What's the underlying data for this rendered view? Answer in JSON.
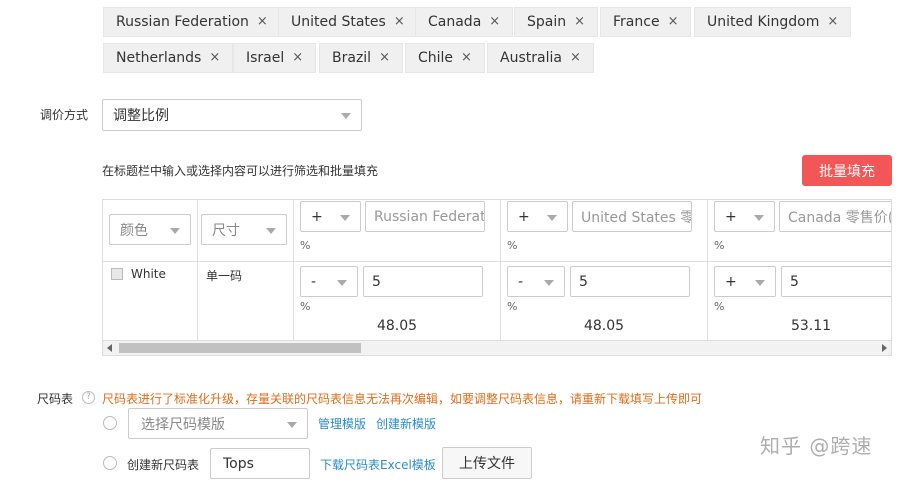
{
  "countries": [
    "Russian Federation",
    "United States",
    "Canada",
    "Spain",
    "France",
    "United Kingdom",
    "Netherlands",
    "Israel",
    "Brazil",
    "Chile",
    "Australia"
  ],
  "remove_glyph": "×",
  "pricing": {
    "label": "调价方式",
    "value": "调整比例"
  },
  "table_hint": "在标题栏中输入或选择内容可以进行筛选和批量填充",
  "batch_fill_label": "批量填充",
  "table": {
    "color_header": "颜色",
    "size_header": "尺寸",
    "pct": "%",
    "columns": [
      {
        "op": "+",
        "placeholder": "Russian Federatic"
      },
      {
        "op": "+",
        "placeholder": "United States 零售"
      },
      {
        "op": "+",
        "placeholder": "Canada 零售价(U"
      }
    ],
    "row": {
      "color": "White",
      "size": "单一码",
      "cells": [
        {
          "op": "-",
          "value": "5",
          "result": "48.05"
        },
        {
          "op": "-",
          "value": "5",
          "result": "48.05"
        },
        {
          "op": "+",
          "value": "5",
          "result": "53.11"
        }
      ]
    }
  },
  "size_chart": {
    "label": "尺码表",
    "help": "?",
    "warning": "尺码表进行了标准化升级，存量关联的尺码表信息无法再次编辑，如要调整尺码表信息，请重新下载填写上传即可",
    "template_placeholder": "选择尺码模版",
    "manage_link": "管理模版",
    "create_link": "创建新模版",
    "new_label": "创建新尺码表",
    "new_value": "Tops",
    "download_link": "下载尺码表Excel模板",
    "upload_label": "上传文件"
  },
  "watermark": "知乎 @跨速"
}
